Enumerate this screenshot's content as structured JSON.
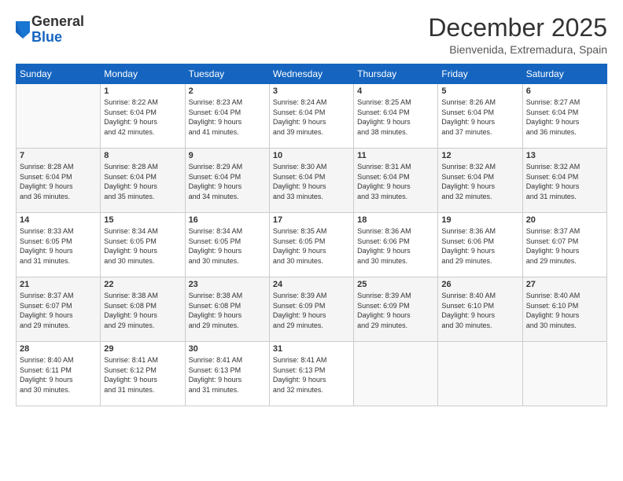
{
  "logo": {
    "general": "General",
    "blue": "Blue"
  },
  "title": "December 2025",
  "location": "Bienvenida, Extremadura, Spain",
  "weekdays": [
    "Sunday",
    "Monday",
    "Tuesday",
    "Wednesday",
    "Thursday",
    "Friday",
    "Saturday"
  ],
  "weeks": [
    [
      {
        "day": "",
        "sunrise": "",
        "sunset": "",
        "daylight": ""
      },
      {
        "day": "1",
        "sunrise": "Sunrise: 8:22 AM",
        "sunset": "Sunset: 6:04 PM",
        "daylight": "Daylight: 9 hours and 42 minutes."
      },
      {
        "day": "2",
        "sunrise": "Sunrise: 8:23 AM",
        "sunset": "Sunset: 6:04 PM",
        "daylight": "Daylight: 9 hours and 41 minutes."
      },
      {
        "day": "3",
        "sunrise": "Sunrise: 8:24 AM",
        "sunset": "Sunset: 6:04 PM",
        "daylight": "Daylight: 9 hours and 39 minutes."
      },
      {
        "day": "4",
        "sunrise": "Sunrise: 8:25 AM",
        "sunset": "Sunset: 6:04 PM",
        "daylight": "Daylight: 9 hours and 38 minutes."
      },
      {
        "day": "5",
        "sunrise": "Sunrise: 8:26 AM",
        "sunset": "Sunset: 6:04 PM",
        "daylight": "Daylight: 9 hours and 37 minutes."
      },
      {
        "day": "6",
        "sunrise": "Sunrise: 8:27 AM",
        "sunset": "Sunset: 6:04 PM",
        "daylight": "Daylight: 9 hours and 36 minutes."
      }
    ],
    [
      {
        "day": "7",
        "sunrise": "Sunrise: 8:28 AM",
        "sunset": "Sunset: 6:04 PM",
        "daylight": "Daylight: 9 hours and 36 minutes."
      },
      {
        "day": "8",
        "sunrise": "Sunrise: 8:28 AM",
        "sunset": "Sunset: 6:04 PM",
        "daylight": "Daylight: 9 hours and 35 minutes."
      },
      {
        "day": "9",
        "sunrise": "Sunrise: 8:29 AM",
        "sunset": "Sunset: 6:04 PM",
        "daylight": "Daylight: 9 hours and 34 minutes."
      },
      {
        "day": "10",
        "sunrise": "Sunrise: 8:30 AM",
        "sunset": "Sunset: 6:04 PM",
        "daylight": "Daylight: 9 hours and 33 minutes."
      },
      {
        "day": "11",
        "sunrise": "Sunrise: 8:31 AM",
        "sunset": "Sunset: 6:04 PM",
        "daylight": "Daylight: 9 hours and 33 minutes."
      },
      {
        "day": "12",
        "sunrise": "Sunrise: 8:32 AM",
        "sunset": "Sunset: 6:04 PM",
        "daylight": "Daylight: 9 hours and 32 minutes."
      },
      {
        "day": "13",
        "sunrise": "Sunrise: 8:32 AM",
        "sunset": "Sunset: 6:04 PM",
        "daylight": "Daylight: 9 hours and 31 minutes."
      }
    ],
    [
      {
        "day": "14",
        "sunrise": "Sunrise: 8:33 AM",
        "sunset": "Sunset: 6:05 PM",
        "daylight": "Daylight: 9 hours and 31 minutes."
      },
      {
        "day": "15",
        "sunrise": "Sunrise: 8:34 AM",
        "sunset": "Sunset: 6:05 PM",
        "daylight": "Daylight: 9 hours and 30 minutes."
      },
      {
        "day": "16",
        "sunrise": "Sunrise: 8:34 AM",
        "sunset": "Sunset: 6:05 PM",
        "daylight": "Daylight: 9 hours and 30 minutes."
      },
      {
        "day": "17",
        "sunrise": "Sunrise: 8:35 AM",
        "sunset": "Sunset: 6:05 PM",
        "daylight": "Daylight: 9 hours and 30 minutes."
      },
      {
        "day": "18",
        "sunrise": "Sunrise: 8:36 AM",
        "sunset": "Sunset: 6:06 PM",
        "daylight": "Daylight: 9 hours and 30 minutes."
      },
      {
        "day": "19",
        "sunrise": "Sunrise: 8:36 AM",
        "sunset": "Sunset: 6:06 PM",
        "daylight": "Daylight: 9 hours and 29 minutes."
      },
      {
        "day": "20",
        "sunrise": "Sunrise: 8:37 AM",
        "sunset": "Sunset: 6:07 PM",
        "daylight": "Daylight: 9 hours and 29 minutes."
      }
    ],
    [
      {
        "day": "21",
        "sunrise": "Sunrise: 8:37 AM",
        "sunset": "Sunset: 6:07 PM",
        "daylight": "Daylight: 9 hours and 29 minutes."
      },
      {
        "day": "22",
        "sunrise": "Sunrise: 8:38 AM",
        "sunset": "Sunset: 6:08 PM",
        "daylight": "Daylight: 9 hours and 29 minutes."
      },
      {
        "day": "23",
        "sunrise": "Sunrise: 8:38 AM",
        "sunset": "Sunset: 6:08 PM",
        "daylight": "Daylight: 9 hours and 29 minutes."
      },
      {
        "day": "24",
        "sunrise": "Sunrise: 8:39 AM",
        "sunset": "Sunset: 6:09 PM",
        "daylight": "Daylight: 9 hours and 29 minutes."
      },
      {
        "day": "25",
        "sunrise": "Sunrise: 8:39 AM",
        "sunset": "Sunset: 6:09 PM",
        "daylight": "Daylight: 9 hours and 29 minutes."
      },
      {
        "day": "26",
        "sunrise": "Sunrise: 8:40 AM",
        "sunset": "Sunset: 6:10 PM",
        "daylight": "Daylight: 9 hours and 30 minutes."
      },
      {
        "day": "27",
        "sunrise": "Sunrise: 8:40 AM",
        "sunset": "Sunset: 6:10 PM",
        "daylight": "Daylight: 9 hours and 30 minutes."
      }
    ],
    [
      {
        "day": "28",
        "sunrise": "Sunrise: 8:40 AM",
        "sunset": "Sunset: 6:11 PM",
        "daylight": "Daylight: 9 hours and 30 minutes."
      },
      {
        "day": "29",
        "sunrise": "Sunrise: 8:41 AM",
        "sunset": "Sunset: 6:12 PM",
        "daylight": "Daylight: 9 hours and 31 minutes."
      },
      {
        "day": "30",
        "sunrise": "Sunrise: 8:41 AM",
        "sunset": "Sunset: 6:13 PM",
        "daylight": "Daylight: 9 hours and 31 minutes."
      },
      {
        "day": "31",
        "sunrise": "Sunrise: 8:41 AM",
        "sunset": "Sunset: 6:13 PM",
        "daylight": "Daylight: 9 hours and 32 minutes."
      },
      {
        "day": "",
        "sunrise": "",
        "sunset": "",
        "daylight": ""
      },
      {
        "day": "",
        "sunrise": "",
        "sunset": "",
        "daylight": ""
      },
      {
        "day": "",
        "sunrise": "",
        "sunset": "",
        "daylight": ""
      }
    ]
  ]
}
